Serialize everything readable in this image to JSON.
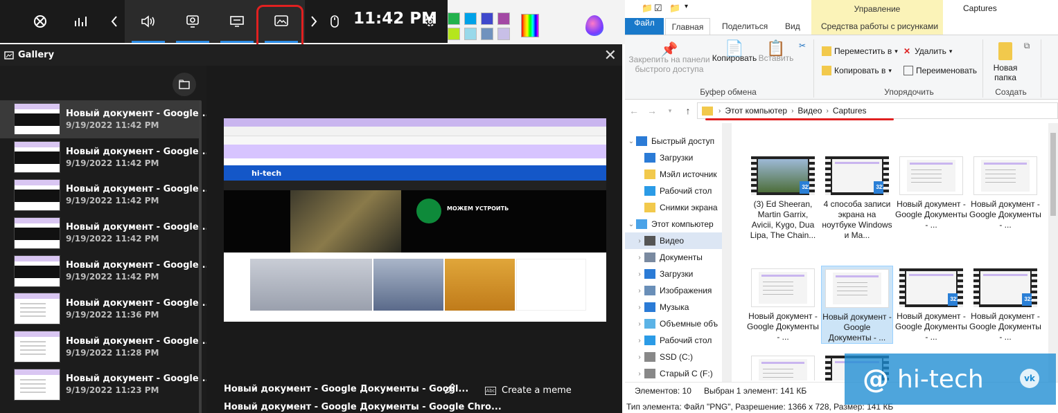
{
  "gamebar": {
    "time": "11:42 PM",
    "icons": [
      "xbox-icon",
      "performance-icon",
      "chevron-left-icon",
      "audio-icon",
      "capture-icon",
      "resources-icon",
      "gallery-icon",
      "chevron-right-icon",
      "mouse-icon",
      "settings-icon"
    ],
    "accent": "#2b8ce6"
  },
  "gallery": {
    "title": "Gallery",
    "items": [
      {
        "name": "Новый документ - Google...",
        "date": "9/19/2022 11:42 PM"
      },
      {
        "name": "Новый документ - Google...",
        "date": "9/19/2022 11:42 PM"
      },
      {
        "name": "Новый документ - Google...",
        "date": "9/19/2022 11:42 PM"
      },
      {
        "name": "Новый документ - Google...",
        "date": "9/19/2022 11:42 PM"
      },
      {
        "name": "Новый документ - Google...",
        "date": "9/19/2022 11:42 PM"
      },
      {
        "name": "Новый документ - Google...",
        "date": "9/19/2022 11:36 PM"
      },
      {
        "name": "Новый документ - Google...",
        "date": "9/19/2022 11:28 PM"
      },
      {
        "name": "Новый документ - Google...",
        "date": "9/19/2022 11:23 PM"
      }
    ],
    "preview": {
      "site_name": "hi-tech",
      "headline": "МОЖЕМ УСТРОИТЬ"
    },
    "caption_line1": "Новый документ - Google Документы - Googl...",
    "caption_line2": "Новый документ - Google Документы - Google Chro...",
    "meme_label": "Create a meme"
  },
  "explorer": {
    "title_manage": "Управление",
    "title_folder": "Captures",
    "tabs": {
      "file": "Файл",
      "home": "Главная",
      "share": "Поделиться",
      "view": "Вид",
      "picture_tools": "Средства работы с рисунками"
    },
    "ribbon": {
      "pin": "Закрепить на панели быстрого доступа",
      "copy": "Копировать",
      "paste": "Вставить",
      "move_to": "Переместить в",
      "copy_to": "Копировать в",
      "delete": "Удалить",
      "rename": "Переименовать",
      "new_folder": "Новая папка",
      "group_clipboard": "Буфер обмена",
      "group_organize": "Упорядочить",
      "group_create": "Создать"
    },
    "breadcrumb": [
      "Этот компьютер",
      "Видео",
      "Captures"
    ],
    "nav": [
      {
        "label": "Быстрый доступ",
        "caret": "v",
        "indent": 0
      },
      {
        "label": "Загрузки",
        "caret": "",
        "indent": 1
      },
      {
        "label": "Мэйл источник",
        "caret": "",
        "indent": 1
      },
      {
        "label": "Рабочий стол",
        "caret": "",
        "indent": 1
      },
      {
        "label": "Снимки экрана",
        "caret": "",
        "indent": 1
      },
      {
        "label": "Этот компьютер",
        "caret": "v",
        "indent": 0
      },
      {
        "label": "Видео",
        "caret": ">",
        "indent": 1
      },
      {
        "label": "Документы",
        "caret": ">",
        "indent": 1
      },
      {
        "label": "Загрузки",
        "caret": ">",
        "indent": 1
      },
      {
        "label": "Изображения",
        "caret": ">",
        "indent": 1
      },
      {
        "label": "Музыка",
        "caret": ">",
        "indent": 1
      },
      {
        "label": "Объемные объ",
        "caret": ">",
        "indent": 1
      },
      {
        "label": "Рабочий стол",
        "caret": ">",
        "indent": 1
      },
      {
        "label": "SSD (C:)",
        "caret": ">",
        "indent": 1
      },
      {
        "label": "Старый С (F:)",
        "caret": ">",
        "indent": 1
      }
    ],
    "files": [
      {
        "label": "(3) Ed Sheeran, Martin Garrix, Avicii, Kygo, Dua Lipa, The Chain...",
        "kind": "video"
      },
      {
        "label": "4 способа записи экрана на ноутбуке Windows и Ma...",
        "kind": "video"
      },
      {
        "label": "Новый документ - Google Документы - ...",
        "kind": "image"
      },
      {
        "label": "Новый документ - Google Документы - ...",
        "kind": "image"
      },
      {
        "label": "Новый документ - Google Документы - ...",
        "kind": "image"
      },
      {
        "label": "Новый документ - Google Документы - ...",
        "kind": "image"
      },
      {
        "label": "Новый документ - Google Документы - ...",
        "kind": "video"
      },
      {
        "label": "Новый документ - Google Документы - ...",
        "kind": "video"
      },
      {
        "label": "",
        "kind": "image"
      },
      {
        "label": "",
        "kind": "video"
      }
    ],
    "status": {
      "count": "Элементов: 10",
      "selected": "Выбран 1 элемент: 141 КБ",
      "details": "Тип элемента: Файл \"PNG\", Разрешение: 1366 x 728, Размер: 141 КБ"
    }
  },
  "watermark": {
    "text": "hi-tech",
    "vk": "vk"
  }
}
